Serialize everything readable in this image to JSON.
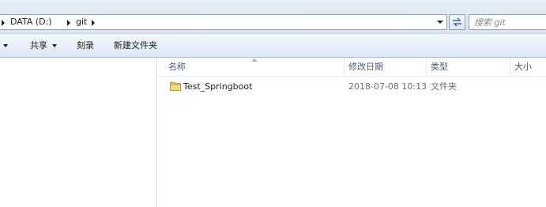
{
  "address_bar": {
    "crumbs": [
      "DATA (D:)",
      "git"
    ],
    "search_placeholder": "搜索 git"
  },
  "command_bar": {
    "share_label": "共享",
    "burn_label": "刻录",
    "new_folder_label": "新建文件夹"
  },
  "columns": {
    "name": "名称",
    "modified": "修改日期",
    "type": "类型",
    "size": "大小"
  },
  "files": [
    {
      "name": "Test_Springboot",
      "modified": "2018-07-08 10:13",
      "type": "文件夹",
      "size": ""
    }
  ],
  "colors": {
    "toolbar_top": "#f4f8fc",
    "toolbar_bottom": "#dce7f4",
    "folder": "#e8c15a",
    "header_text": "#4d5b6f"
  }
}
